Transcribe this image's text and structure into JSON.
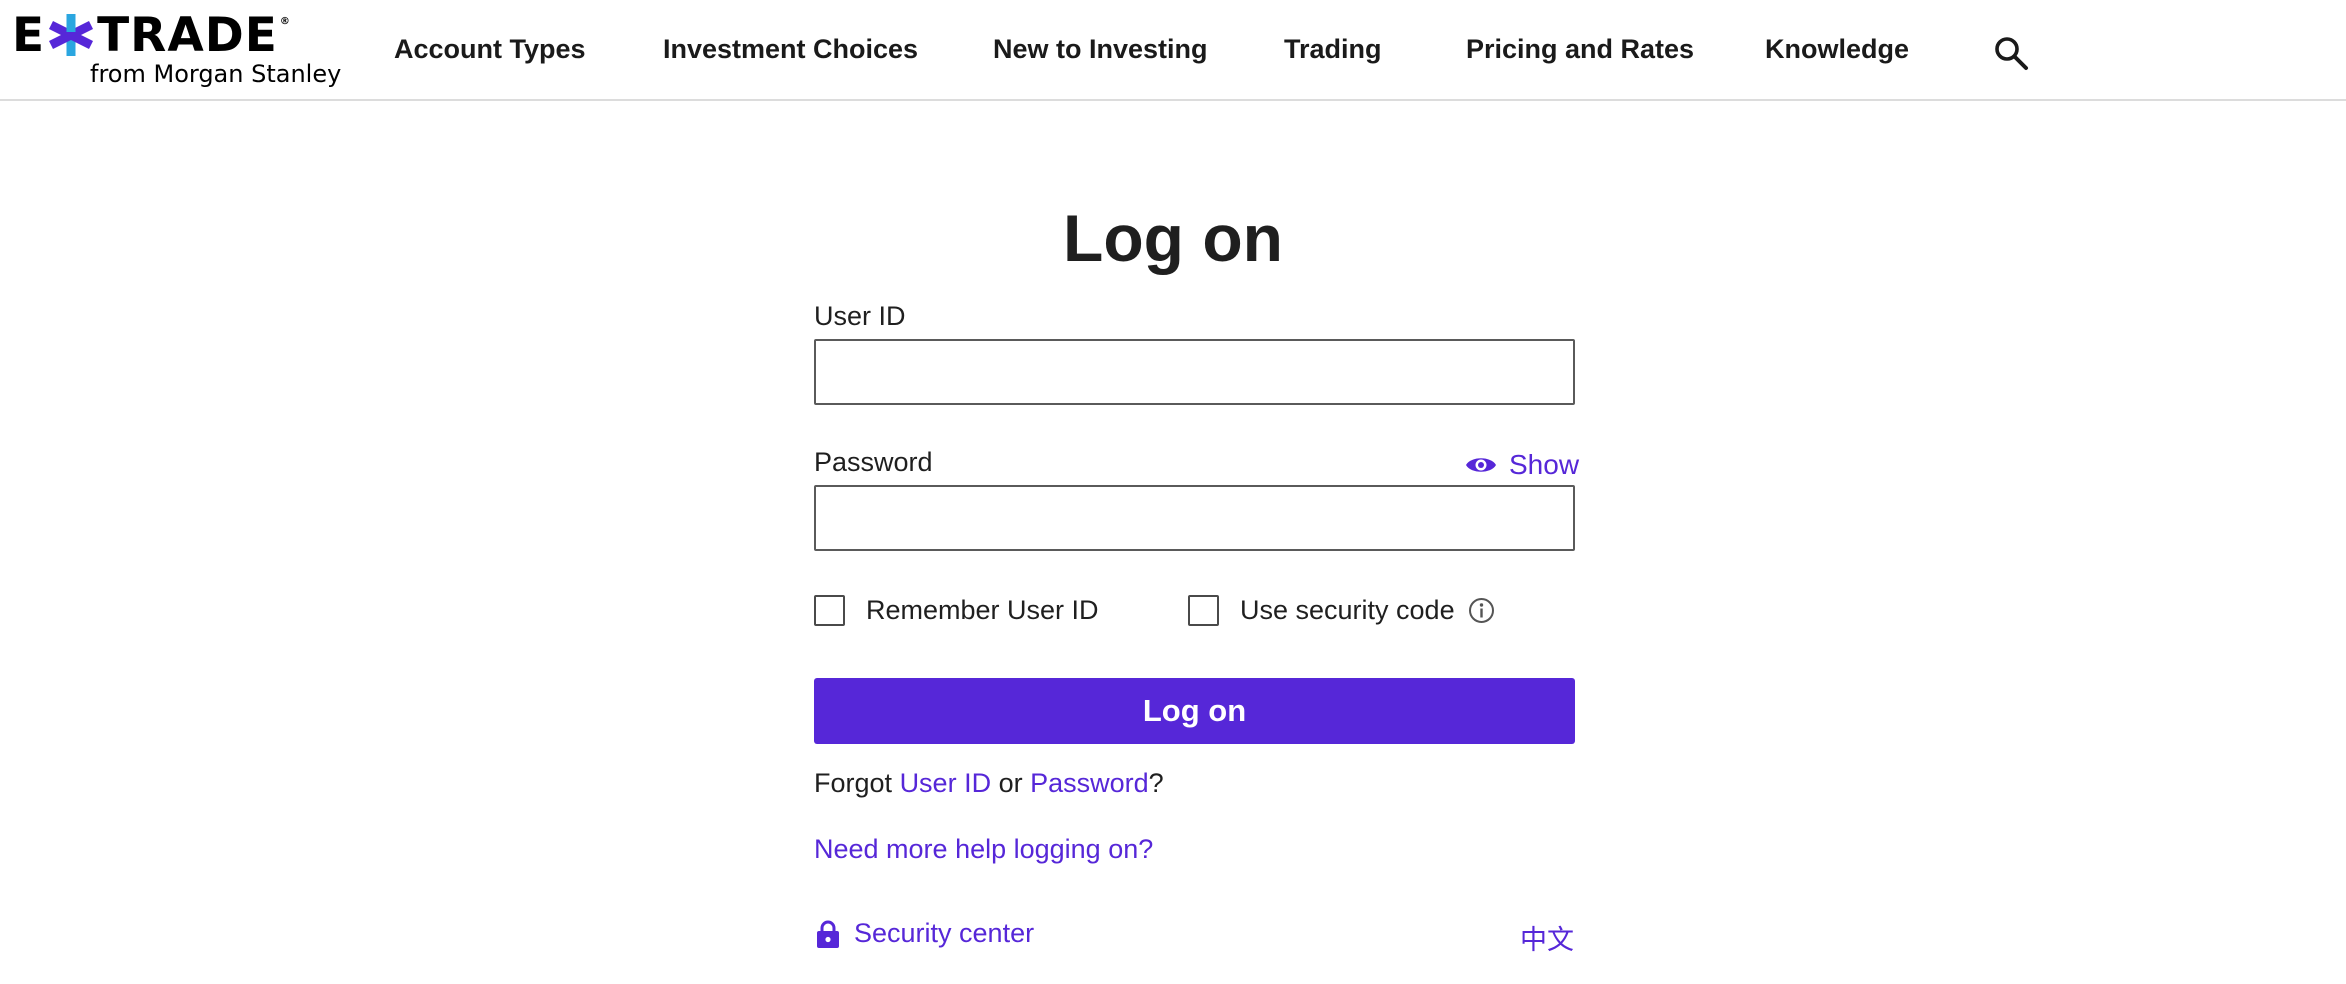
{
  "brand": {
    "logo_text_start": "E",
    "logo_text_end": "TRADE",
    "logo_sub": "from Morgan Stanley",
    "accent_color": "#5627d8",
    "star_colors": [
      "#5627d8",
      "#2aa6e0"
    ]
  },
  "nav": {
    "items": [
      {
        "label": "Account Types"
      },
      {
        "label": "Investment Choices"
      },
      {
        "label": "New to Investing"
      },
      {
        "label": "Trading"
      },
      {
        "label": "Pricing and Rates"
      },
      {
        "label": "Knowledge"
      }
    ],
    "search_icon": "search-icon"
  },
  "login": {
    "title": "Log on",
    "user_id_label": "User ID",
    "user_id_value": "",
    "password_label": "Password",
    "password_value": "",
    "show_label": "Show",
    "show_icon": "eye-icon",
    "remember_label": "Remember User ID",
    "remember_checked": false,
    "security_code_label": "Use security code",
    "security_code_checked": false,
    "info_icon": "info-icon",
    "submit_label": "Log on",
    "forgot_prefix": "Forgot",
    "forgot_user_id": "User ID",
    "forgot_or": "or",
    "forgot_password": "Password",
    "forgot_suffix": "?",
    "help_link": "Need more help logging on?",
    "security_center": "Security center",
    "security_icon": "lock-icon",
    "language_link": "中文"
  }
}
